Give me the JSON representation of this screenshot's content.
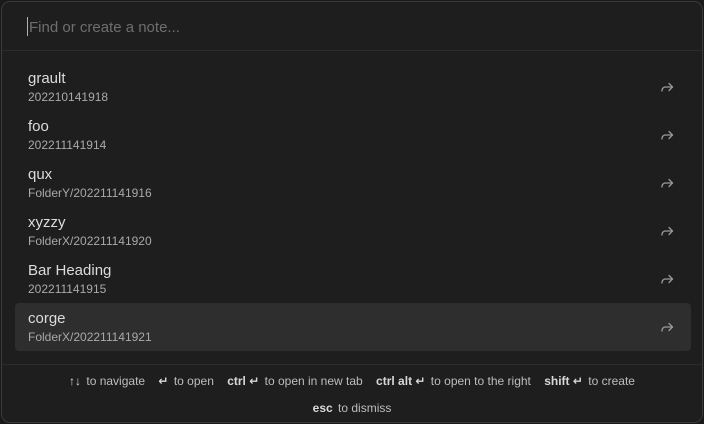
{
  "search": {
    "placeholder": "Find or create a note...",
    "value": ""
  },
  "items": [
    {
      "title": "grault",
      "path": "202210141918",
      "icon": "open-arrow-icon",
      "selected": false
    },
    {
      "title": "foo",
      "path": "202211141914",
      "icon": "open-arrow-icon",
      "selected": false
    },
    {
      "title": "qux",
      "path": "FolderY/202211141916",
      "icon": "open-arrow-icon",
      "selected": false
    },
    {
      "title": "xyzzy",
      "path": "FolderX/202211141920",
      "icon": "open-arrow-icon",
      "selected": false
    },
    {
      "title": "Bar Heading",
      "path": "202211141915",
      "icon": "open-arrow-icon",
      "selected": false
    },
    {
      "title": "corge",
      "path": "FolderX/202211141921",
      "icon": "open-arrow-icon",
      "selected": true
    }
  ],
  "instructions": [
    {
      "key": "↑↓",
      "desc": "to navigate"
    },
    {
      "key": "↵",
      "desc": "to open"
    },
    {
      "key": "ctrl ↵",
      "desc": "to open in new tab"
    },
    {
      "key": "ctrl alt ↵",
      "desc": "to open to the right"
    },
    {
      "key": "shift ↵",
      "desc": "to create"
    },
    {
      "key": "esc",
      "desc": "to dismiss"
    }
  ],
  "colors": {
    "background": "#1e1e1e",
    "selected_row": "#2e2e2e",
    "text": "#dcdcdc",
    "muted_text": "#a9a9a9"
  }
}
